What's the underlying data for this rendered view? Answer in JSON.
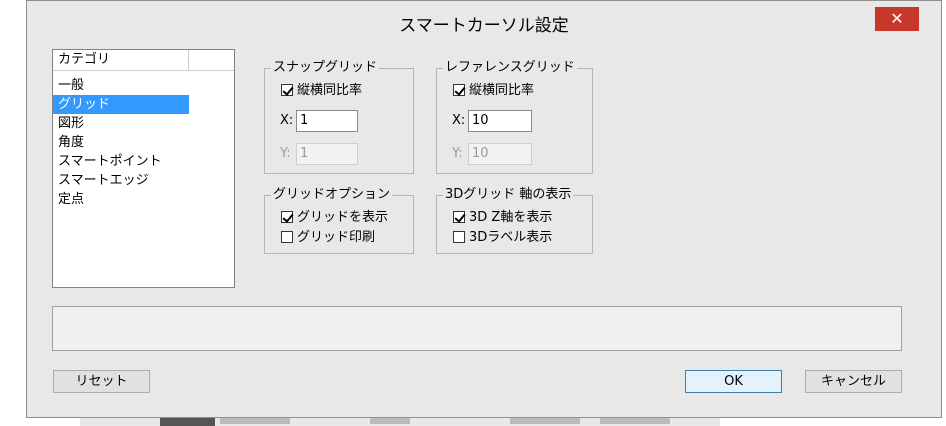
{
  "dialog": {
    "title": "スマートカーソル設定",
    "close_symbol": "✕"
  },
  "categories": {
    "header": "カテゴリ",
    "items": [
      {
        "label": "一般",
        "selected": false
      },
      {
        "label": "グリッド",
        "selected": true
      },
      {
        "label": "図形",
        "selected": false
      },
      {
        "label": "角度",
        "selected": false
      },
      {
        "label": "スマートポイント",
        "selected": false
      },
      {
        "label": "スマートエッジ",
        "selected": false
      },
      {
        "label": "定点",
        "selected": false
      }
    ]
  },
  "snap_grid": {
    "legend": "スナップグリッド",
    "aspect_label": "縦横同比率",
    "aspect_checked": true,
    "x_label": "X:",
    "x_value": "1",
    "y_label": "Y:",
    "y_value": "1"
  },
  "reference_grid": {
    "legend": "レファレンスグリッド",
    "aspect_label": "縦横同比率",
    "aspect_checked": true,
    "x_label": "X:",
    "x_value": "10",
    "y_label": "Y:",
    "y_value": "10"
  },
  "grid_options": {
    "legend": "グリッドオプション",
    "show_grid_label": "グリッドを表示",
    "show_grid_checked": true,
    "print_grid_label": "グリッド印刷",
    "print_grid_checked": false
  },
  "grid_axis": {
    "legend": "3Dグリッド 軸の表示",
    "z_axis_label": "3D Z軸を表示",
    "z_axis_checked": true,
    "label_3d": "3Dラベル表示",
    "label_3d_checked": false
  },
  "buttons": {
    "reset": "リセット",
    "ok": "OK",
    "cancel": "キャンセル"
  },
  "colors": {
    "selection": "#3399ff",
    "close_button": "#c7382a",
    "dialog_bg": "#e8e8e8"
  }
}
